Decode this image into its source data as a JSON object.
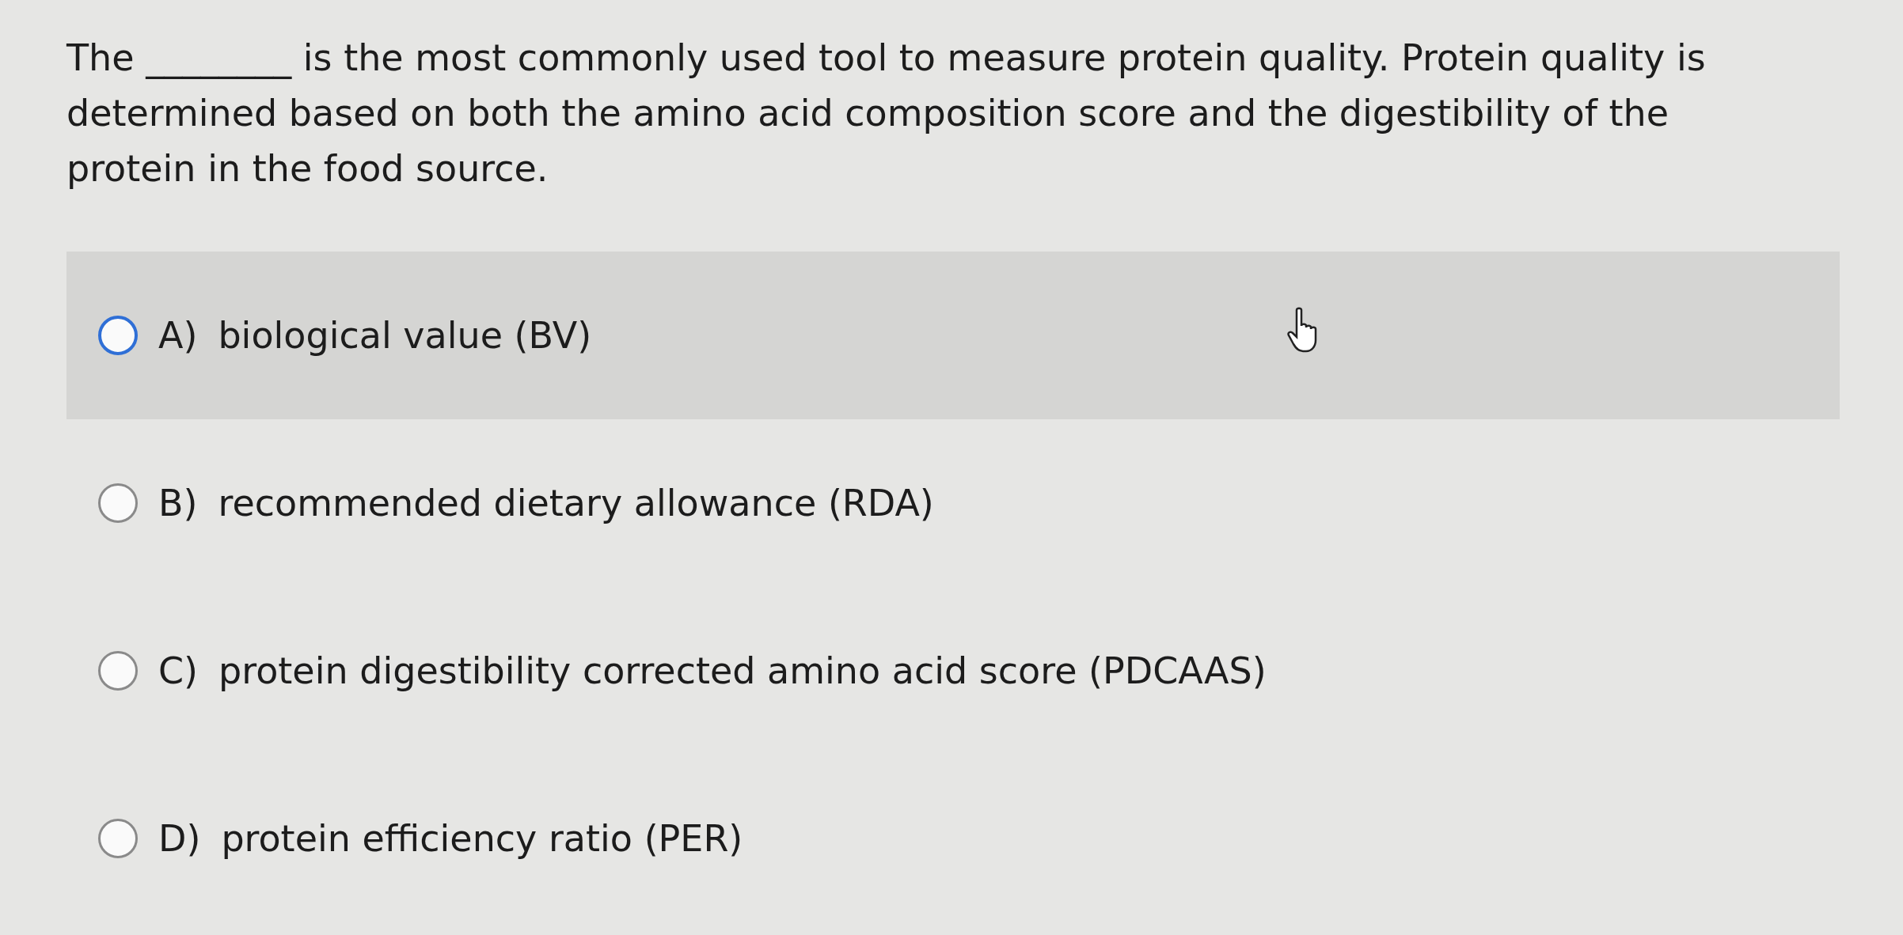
{
  "question": "The ________ is the most commonly used tool to measure protein quality. Protein quality is determined based on both the amino acid composition score and the digestibility of the protein in the food source.",
  "options": [
    {
      "letter": "A)",
      "text": "biological value (BV)",
      "selected": false,
      "hovered": true
    },
    {
      "letter": "B)",
      "text": "recommended dietary allowance (RDA)",
      "selected": false,
      "hovered": false
    },
    {
      "letter": "C)",
      "text": "protein digestibility corrected amino acid score (PDCAAS)",
      "selected": false,
      "hovered": false
    },
    {
      "letter": "D)",
      "text": "protein efficiency ratio (PER)",
      "selected": false,
      "hovered": false
    }
  ]
}
